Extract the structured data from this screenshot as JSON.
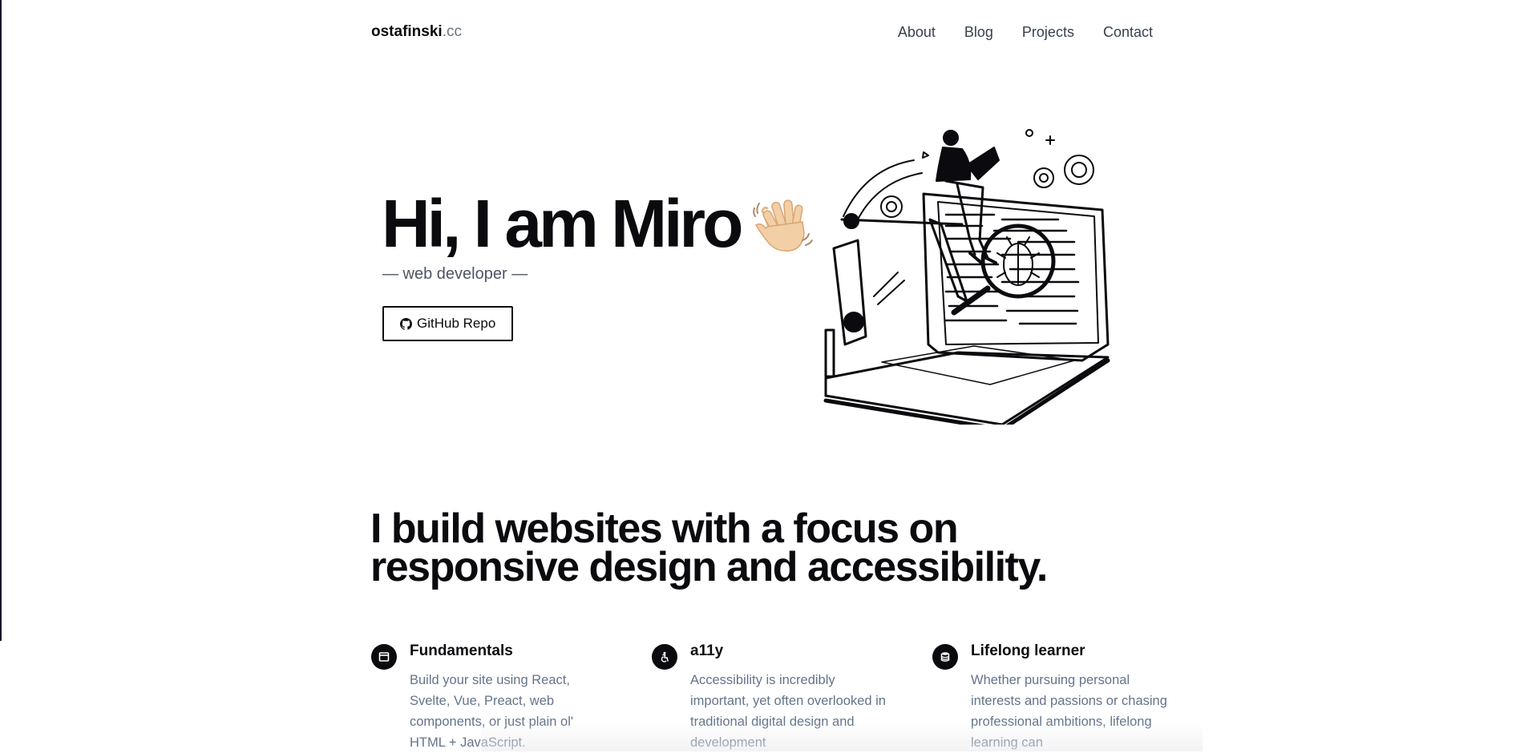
{
  "nav": {
    "brand_name": "ostafinski",
    "brand_tld": ".cc",
    "links": [
      "About",
      "Blog",
      "Projects",
      "Contact"
    ]
  },
  "hero": {
    "title": "Hi, I am Miro",
    "subtitle": "— web developer —",
    "button_label": "GitHub Repo",
    "button_icon": "github-icon",
    "emoji_icon": "waving-hand-icon",
    "illustration_icon": "developer-on-laptop-illustration"
  },
  "statement": "I build websites with a focus on responsive design and accessibility.",
  "features": [
    {
      "icon": "browser-window-icon",
      "title": "Fundamentals",
      "text": "Build your site using React, Svelte, Vue, Preact, web components, or just plain ol' HTML + JavaScript."
    },
    {
      "icon": "accessibility-icon",
      "title": "a11y",
      "text": "Accessibility is incredibly important, yet often overlooked in traditional digital design and development"
    },
    {
      "icon": "database-icon",
      "title": "Lifelong learner",
      "text": "Whether pursuing personal interests and passions or chasing professional ambitions, lifelong learning can"
    }
  ],
  "colors": {
    "text": "#0b0b0f",
    "muted": "#64748b",
    "nav_link": "#374151",
    "background": "#ffffff"
  }
}
